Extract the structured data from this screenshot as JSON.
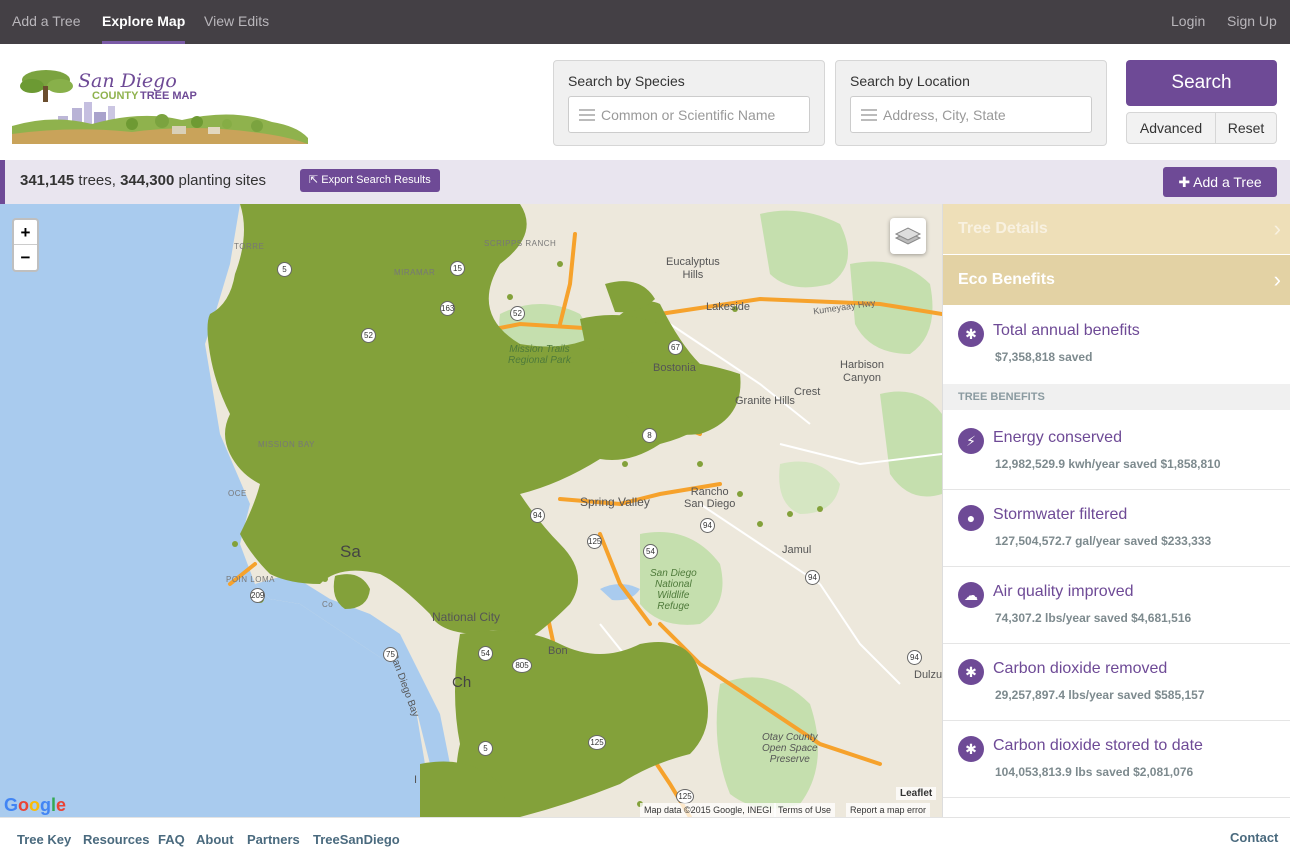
{
  "topnav": {
    "add_tree": "Add a Tree",
    "explore_map": "Explore Map",
    "view_edits": "View Edits",
    "login": "Login",
    "sign_up": "Sign Up"
  },
  "logo": {
    "line1": "San Diego",
    "line2": "COUNTY",
    "line3": "TREE MAP"
  },
  "search": {
    "species_label": "Search by Species",
    "species_placeholder": "Common or Scientific Name",
    "location_label": "Search by Location",
    "location_placeholder": "Address, City, State",
    "search_button": "Search",
    "advanced_button": "Advanced",
    "reset_button": "Reset"
  },
  "results": {
    "trees_count": "341,145",
    "trees_word": "trees,",
    "sites_count": "344,300",
    "sites_word": "planting sites",
    "export_label": "Export Search Results",
    "add_tree_label": "Add a Tree"
  },
  "map": {
    "zoom_in": "+",
    "zoom_out": "−",
    "labels": {
      "scripps_ranch": "SCRIPPS RANCH",
      "miramar": "MIRAMAR",
      "torrey": "TORRE",
      "eucalyptus_hills": "Eucalyptus\nHills",
      "lakeside": "Lakeside",
      "bostonia": "Bostonia",
      "harbison_canyon": "Harbison\nCanyon",
      "crest": "Crest",
      "granite_hills": "Granite Hills",
      "mission_trails": "Mission Trails\nRegional Park",
      "mission_bay": "MISSION BAY",
      "spring_valley": "Spring Valley",
      "rancho_san_diego": "Rancho\nSan Diego",
      "jamul": "Jamul",
      "san_diego": "Sa",
      "point_loma": "POIN  LOMA",
      "national_city": "National City",
      "san_diego_bay": "San Diego Bay",
      "sd_refuge": "San Diego\nNational\nWildlife\nRefuge",
      "otay": "Otay County\nOpen Space\nPreserve",
      "dulzura": "Dulzu",
      "kumeyaay": "Kumeyaay Hwy",
      "oce": "OCE",
      "chula": "Ch",
      "imperial": "I",
      "bon": "Bon",
      "co": "Co"
    },
    "shields": [
      "5",
      "15",
      "163",
      "52",
      "52",
      "67",
      "8",
      "94",
      "94",
      "94",
      "54",
      "125",
      "54",
      "805",
      "5",
      "75",
      "125",
      "125",
      "94",
      "209"
    ],
    "google": "Google",
    "attribution": "Map data ©2015 Google, INEGI",
    "terms": "Terms of Use",
    "report": "Report a map error",
    "leaflet": "Leaflet"
  },
  "panel": {
    "tree_details": "Tree Details",
    "eco_benefits": "Eco Benefits",
    "total": {
      "title": "Total annual benefits",
      "value": "$7,358,818 saved"
    },
    "section_label": "TREE BENEFITS",
    "benefits": [
      {
        "title": "Energy conserved",
        "value": "12,982,529.9 kwh/year saved $1,858,810",
        "icon": "bolt-icon"
      },
      {
        "title": "Stormwater filtered",
        "value": "127,504,572.7 gal/year saved $233,333",
        "icon": "droplet-icon"
      },
      {
        "title": "Air quality improved",
        "value": "74,307.2 lbs/year saved $4,681,516",
        "icon": "cloud-icon"
      },
      {
        "title": "Carbon dioxide removed",
        "value": "29,257,897.4 lbs/year saved $585,157",
        "icon": "asterisk-icon"
      },
      {
        "title": "Carbon dioxide stored to date",
        "value": "104,053,813.9 lbs saved $2,081,076",
        "icon": "asterisk-icon"
      }
    ]
  },
  "footer": {
    "tree_key": "Tree Key",
    "resources": "Resources",
    "faq": "FAQ",
    "about": "About",
    "partners": "Partners",
    "treesandiego": "TreeSanDiego",
    "contact": "Contact"
  }
}
